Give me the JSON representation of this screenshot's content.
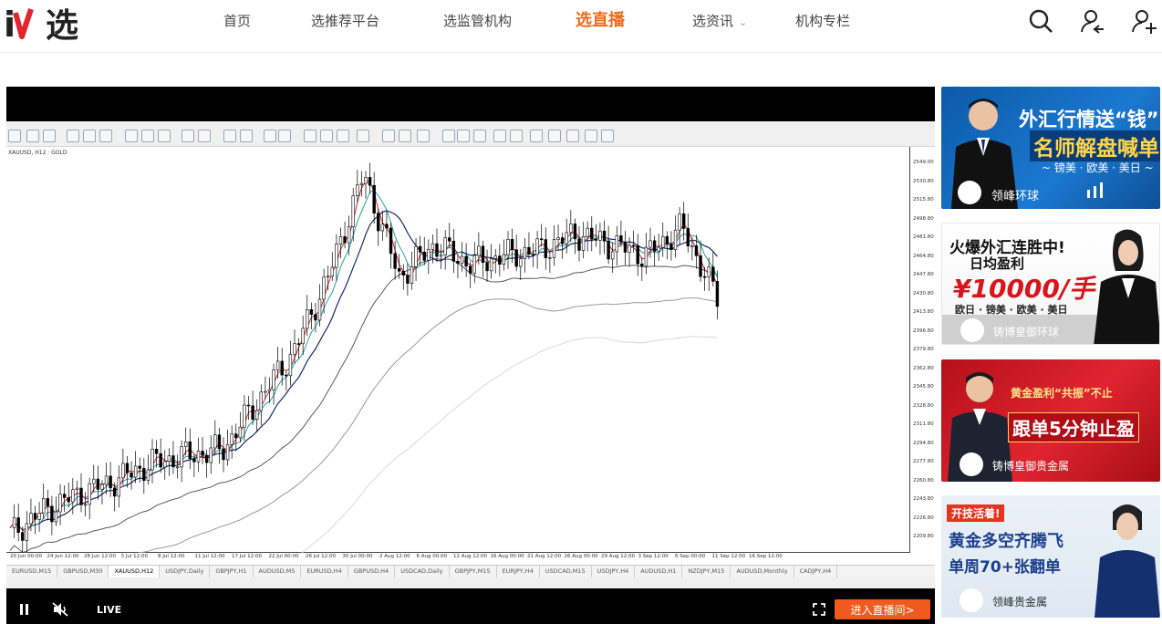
{
  "header": {
    "logo_text": "汇选",
    "nav": [
      {
        "label": "首页"
      },
      {
        "label": "选推荐平台"
      },
      {
        "label": "选监管机构"
      },
      {
        "label": "选直播"
      },
      {
        "label": "选资讯"
      },
      {
        "label": "机构专栏"
      }
    ],
    "active_nav": "选直播",
    "icons": [
      "search-icon",
      "user-login-icon",
      "user-register-icon"
    ]
  },
  "player": {
    "mt4": {
      "chart_title": "XAUUSD, H12 · GOLD",
      "price_labels": [
        "2549.00",
        "2530.80",
        "2515.80",
        "2498.80",
        "2481.80",
        "2464.80",
        "2447.80",
        "2430.80",
        "2413.80",
        "2396.80",
        "2379.80",
        "2362.80",
        "2345.80",
        "2328.80",
        "2311.80",
        "2294.80",
        "2277.80",
        "2260.80",
        "2243.80",
        "2226.80",
        "2209.80"
      ],
      "time_labels": [
        "20 Jun 00:00",
        "24 Jun 12:00",
        "28 Jun 12:00",
        "3 Jul 12:00",
        "8 Jul 12:00",
        "11 Jul 12:00",
        "17 Jul 12:00",
        "22 Jul 00:00",
        "26 Jul 12:00",
        "30 Jul 00:00",
        "2 Aug 12:00",
        "6 Aug 00:00",
        "12 Aug 12:00",
        "16 Aug 00:00",
        "21 Aug 12:00",
        "26 Aug 00:00",
        "29 Aug 12:00",
        "3 Sep 12:00",
        "6 Sep 00:00",
        "11 Sep 12:00",
        "16 Sep 12:00"
      ],
      "symbol_tabs": [
        "EURUSD,M15",
        "GBPUSD,M30",
        "XAUUSD,H12",
        "USDJPY,Daily",
        "GBPJPY,H1",
        "AUDUSD,M5",
        "EURUSD,H4",
        "GBPUSD,H4",
        "USDCAD,Daily",
        "GBPJPY,M15",
        "EURJPY,H4",
        "USDCAD,M15",
        "USDJPY,H4",
        "AUDUSD,H1",
        "NZDJPY,M15",
        "AUDUSD,Monthly",
        "CADJPY,H4"
      ],
      "active_tab": "XAUUSD,H12"
    },
    "controls": {
      "live_label": "LIVE",
      "enter_label": "进入直播间>"
    }
  },
  "ads": [
    {
      "line1": "外汇行情送“钱”",
      "line2": "名师解盘喊单!",
      "line3": "~ 镑美 · 欧美 · 美日 ~",
      "brand": "领峰环球"
    },
    {
      "line1": "火爆外汇连胜中!",
      "line2": "日均盈利",
      "line3": "¥10000/手",
      "line4": "欧日 · 镑美 · 欧美 · 美日",
      "brand": "铸博皇御环球"
    },
    {
      "line1": "黄金盈利“共振”不止",
      "line2": "跟单5分钟止盈",
      "brand": "铸博皇御贵金属"
    },
    {
      "line1": "开技活着!",
      "line2": "黄金多空齐腾飞",
      "line3": "单周70+张翻单",
      "brand": "领峰贵金属"
    }
  ],
  "chart_data": {
    "type": "line",
    "title": "XAUUSD, H12",
    "x": [
      "20 Jun",
      "24 Jun",
      "28 Jun",
      "3 Jul",
      "8 Jul",
      "11 Jul",
      "17 Jul",
      "22 Jul",
      "26 Jul",
      "30 Jul",
      "2 Aug",
      "6 Aug",
      "12 Aug",
      "16 Aug",
      "21 Aug",
      "26 Aug",
      "29 Aug",
      "3 Sep",
      "6 Sep",
      "11 Sep",
      "16 Sep"
    ],
    "series": [
      {
        "values": [
          2212,
          2235,
          2250,
          2262,
          2278,
          2285,
          2290,
          2335,
          2380,
          2450,
          2545,
          2450,
          2480,
          2462,
          2470,
          2475,
          2490,
          2480,
          2470,
          2496,
          2430
        ]
      }
    ],
    "ylim": [
      2200,
      2560
    ],
    "grid": false
  }
}
